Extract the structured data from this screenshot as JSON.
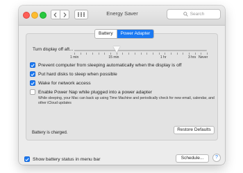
{
  "window": {
    "title": "Energy Saver",
    "search_placeholder": "Search"
  },
  "tabs": [
    {
      "label": "Battery",
      "active": false
    },
    {
      "label": "Power Adapter",
      "active": true
    }
  ],
  "display_sleep": {
    "label": "Turn display off aft...",
    "value_fraction": 0.32,
    "ticks": [
      "1 min",
      "15 min",
      "1 hr",
      "3 hrs",
      "Never"
    ]
  },
  "options": [
    {
      "label": "Prevent computer from sleeping automatically when the display is off",
      "checked": true
    },
    {
      "label": "Put hard disks to sleep when possible",
      "checked": true
    },
    {
      "label": "Wake for network access",
      "checked": true
    },
    {
      "label": "Enable Power Nap while plugged into a power adapter",
      "checked": false
    }
  ],
  "power_nap_note": "While sleeping, your Mac can back up using Time Machine and periodically check for new email, calendar, and other iCloud updates",
  "battery_status": "Battery is charged.",
  "buttons": {
    "restore_defaults": "Restore Defaults",
    "schedule": "Schedule...",
    "help": "?"
  },
  "show_battery_status": {
    "label": "Show battery status in menu bar",
    "checked": true
  },
  "colors": {
    "accent": "#1b79f2"
  }
}
